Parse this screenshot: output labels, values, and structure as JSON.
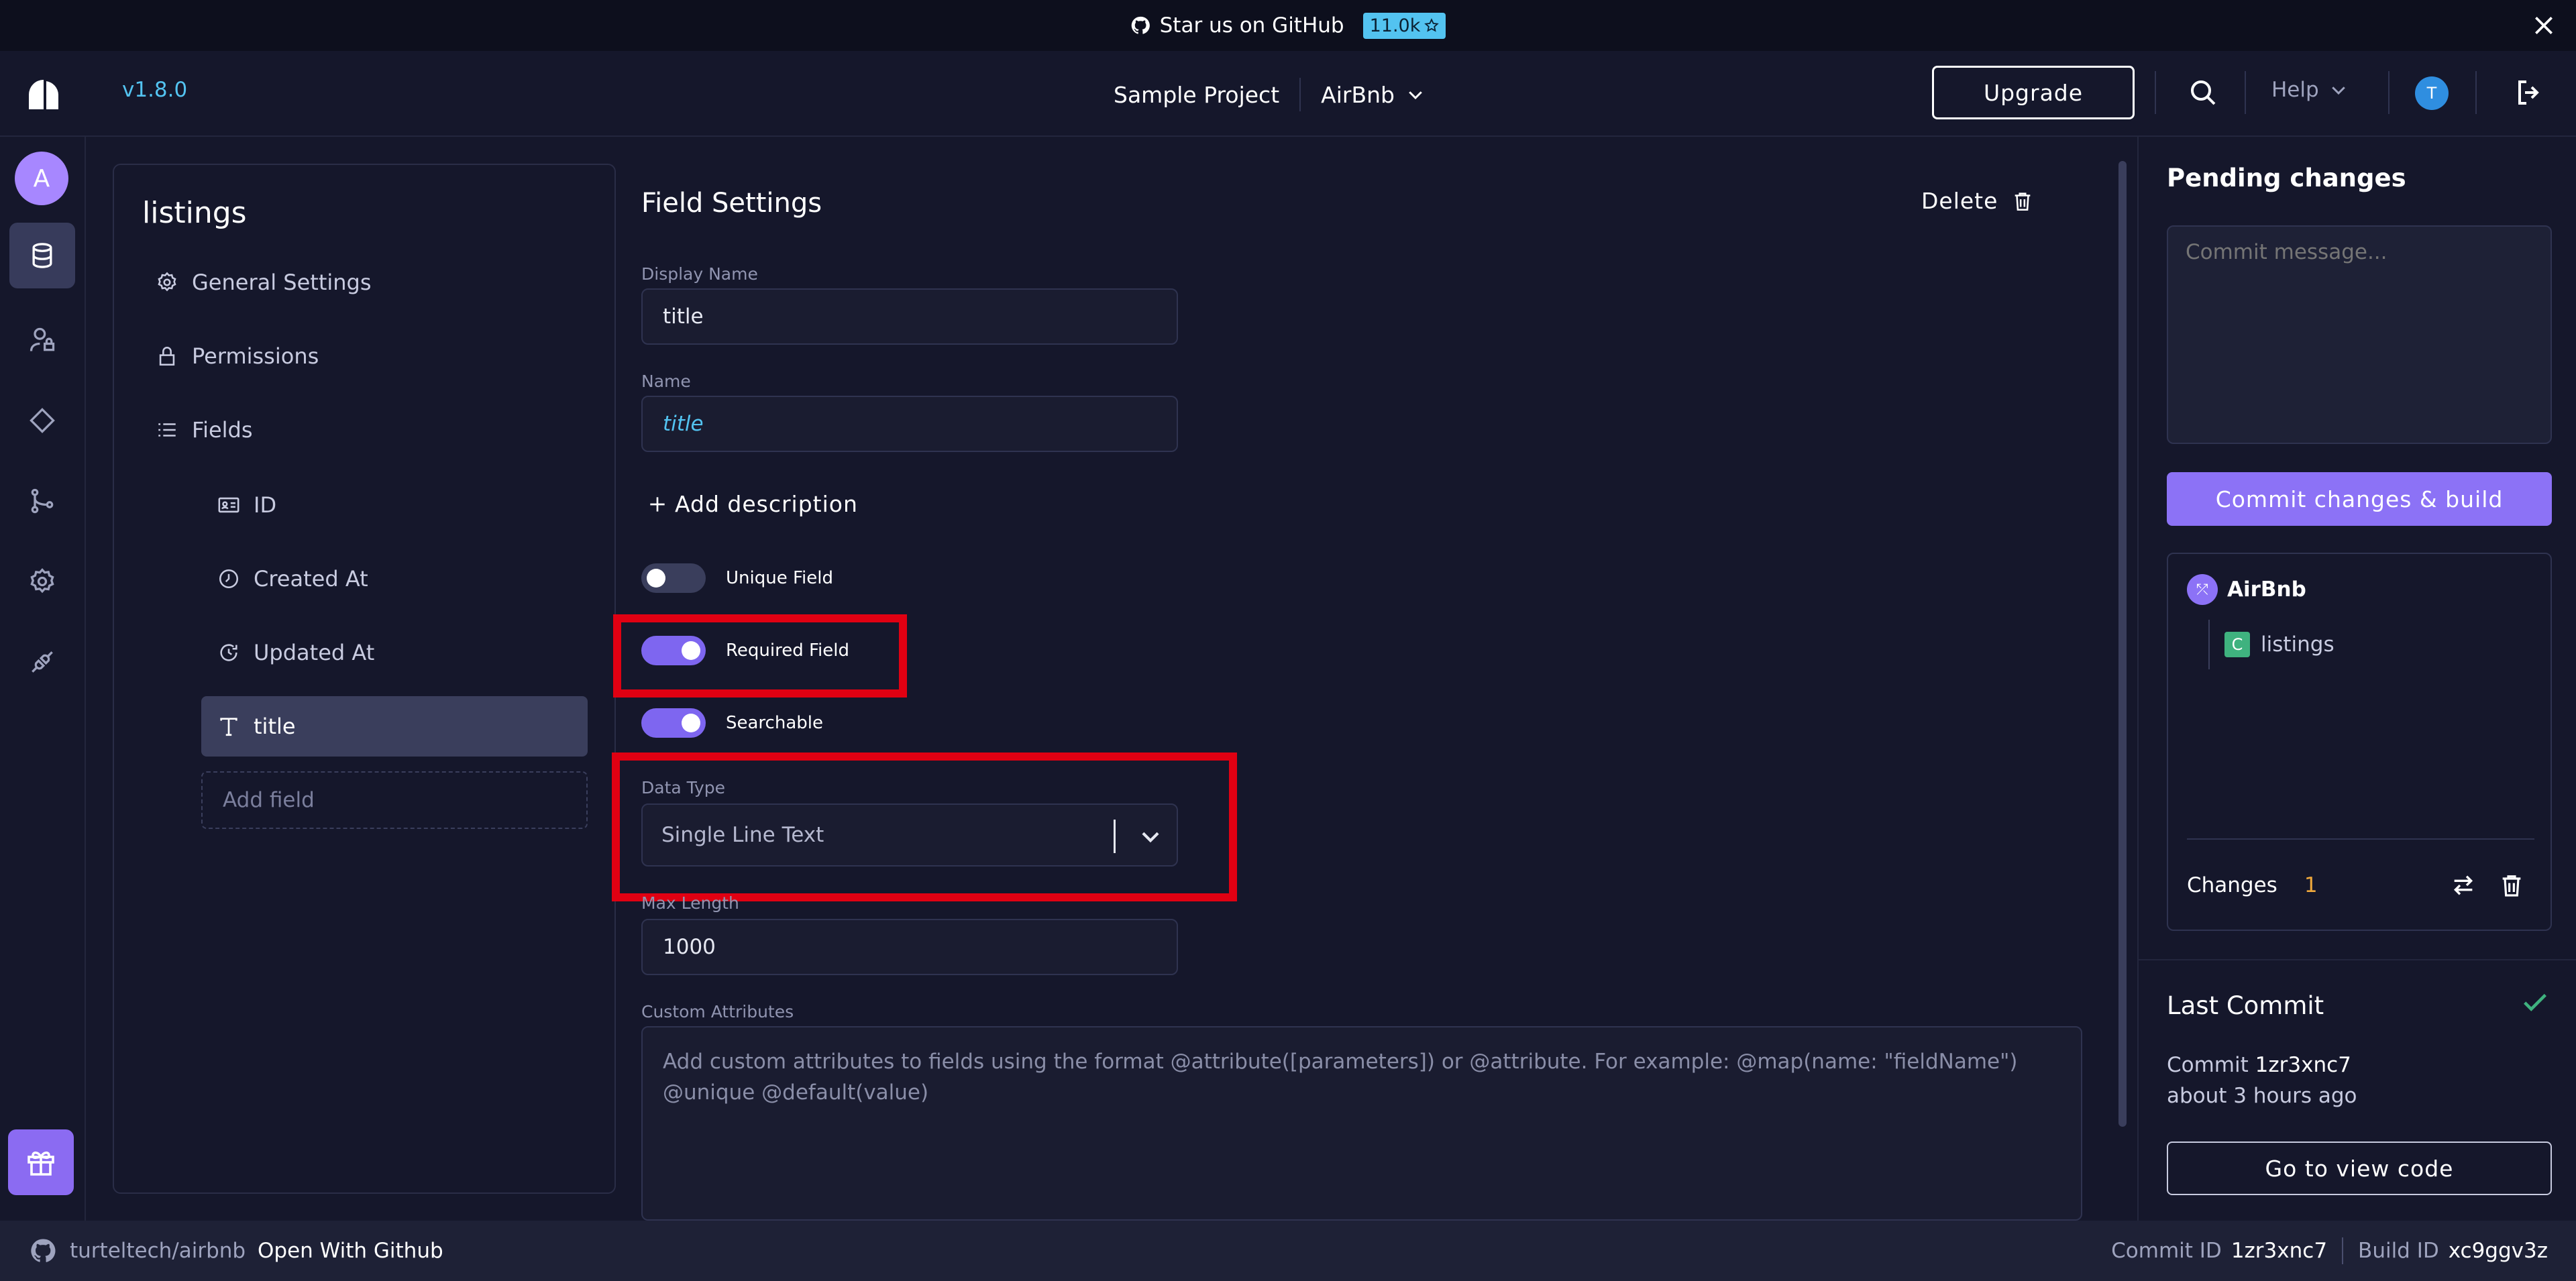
{
  "banner": {
    "text": "Star us on GitHub",
    "stars": "11.0k"
  },
  "header": {
    "version": "v1.8.0",
    "project": "Sample Project",
    "resource": "AirBnb",
    "upgrade_label": "Upgrade",
    "help_label": "Help",
    "user_initial": "T"
  },
  "rail": {
    "workspace_initial": "A"
  },
  "entity": {
    "name": "listings",
    "nav": [
      "General Settings",
      "Permissions",
      "Fields"
    ],
    "fields": [
      "ID",
      "Created At",
      "Updated At",
      "title"
    ],
    "active_field": "title",
    "add_field_placeholder": "Add field"
  },
  "field_settings": {
    "title": "Field Settings",
    "delete_label": "Delete",
    "display_name_label": "Display Name",
    "display_name_value": "title",
    "name_label": "Name",
    "name_value": "title",
    "add_description_label": "Add description",
    "toggles": {
      "unique": {
        "label": "Unique Field",
        "on": false
      },
      "required": {
        "label": "Required Field",
        "on": true
      },
      "searchable": {
        "label": "Searchable",
        "on": true
      }
    },
    "data_type_label": "Data Type",
    "data_type_value": "Single Line Text",
    "max_length_label": "Max Length",
    "max_length_value": "1000",
    "custom_attributes_label": "Custom Attributes",
    "custom_attributes_placeholder": "Add custom attributes to fields using the format @attribute([parameters]) or @attribute. For example: @map(name: \"fieldName\") @unique @default(value)"
  },
  "pending": {
    "title": "Pending changes",
    "commit_placeholder": "Commit message...",
    "commit_button": "Commit changes & build",
    "resource": "AirBnb",
    "changed_entity": "listings",
    "changed_entity_badge": "C",
    "changes_label": "Changes",
    "changes_count": "1"
  },
  "last_commit": {
    "title": "Last Commit",
    "commit_prefix": "Commit",
    "commit_id": "1zr3xnc7",
    "time": "about 3 hours ago",
    "view_code_label": "Go to view code"
  },
  "footer": {
    "repo": "turteltech/airbnb",
    "open_label": "Open With Github",
    "commit_id_label": "Commit ID",
    "commit_id": "1zr3xnc7",
    "build_id_label": "Build ID",
    "build_id": "xc9ggv3z"
  },
  "colors": {
    "background": "#15172b",
    "accent": "#8c72f6",
    "link": "#53c3f0",
    "highlight": "#e00012"
  }
}
